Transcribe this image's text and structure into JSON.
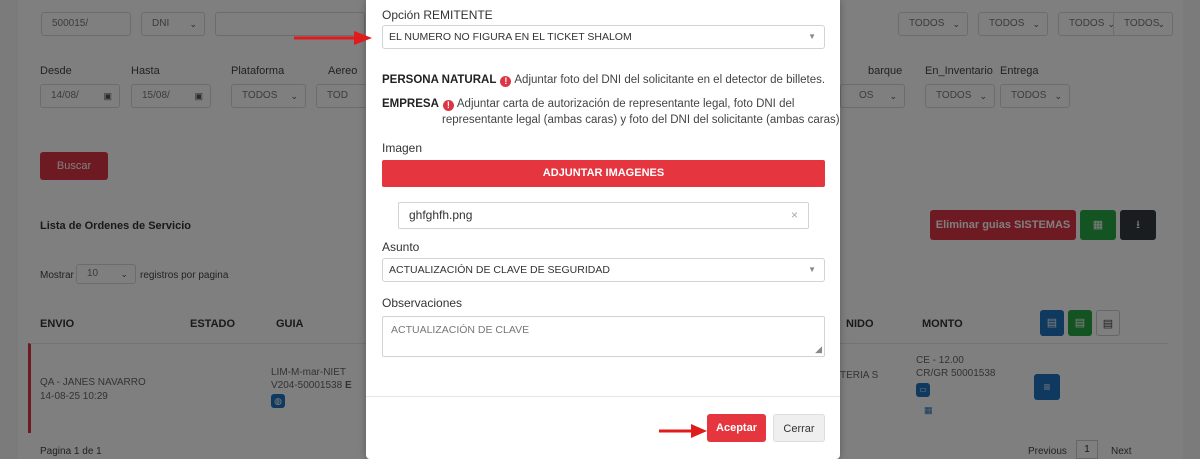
{
  "background": {
    "filter_row1": {
      "code_value": "500015/",
      "doc_type": "DNI",
      "right_selects": [
        "TODOS",
        "TODOS",
        "TODOS",
        "TODOS"
      ]
    },
    "filters": {
      "desde_label": "Desde",
      "desde_value": "14/08/",
      "hasta_label": "Hasta",
      "hasta_value": "15/08/",
      "plataforma_label": "Plataforma",
      "plataforma_value": "TODOS",
      "aereo_label": "Aereo",
      "aereo_value": "TOD",
      "embarque_label": "barque",
      "embarque_value": "OS",
      "inventario_label": "En_Inventario",
      "inventario_value": "TODOS",
      "entrega_label": "Entrega",
      "entrega_value": "TODOS"
    },
    "buscar_label": "Buscar",
    "list_title": "Lista de Ordenes de Servicio",
    "eliminar_label": "Eliminar guias SISTEMAS",
    "mostrar_label": "Mostrar",
    "mostrar_value": "10",
    "registros_label": "registros por pagina",
    "table_headers": [
      "ENVIO",
      "ESTADO",
      "GUIA",
      "NIDO",
      "MONTO"
    ],
    "row": {
      "envio_name": "QA - JANES NAVARRO",
      "envio_date": "14-08-25 10:29",
      "guia_line1": "LIM-M-mar-NIET",
      "guia_line2": "V204-50001538",
      "guia_mark": "E",
      "nido": "TERIA S",
      "monto_line1": "CE - 12.00",
      "monto_line2": "CR/GR 50001538"
    },
    "pagination_text": "Pagina 1 de 1",
    "previous_label": "Previous",
    "page_number": "1",
    "next_label": "Next"
  },
  "modal": {
    "remitente_label": "Opción REMITENTE",
    "remitente_value": "EL NUMERO NO FIGURA EN EL TICKET SHALOM",
    "persona_natural_title": "PERSONA NATURAL",
    "persona_natural_text": "Adjuntar foto del DNI del solicitante en el detector de billetes.",
    "empresa_title": "EMPRESA",
    "empresa_text_1": "Adjuntar carta de autorización de representante legal, foto DNI del",
    "empresa_text_2": "representante legal (ambas caras) y foto del DNI del solicitante (ambas caras)",
    "imagen_label": "Imagen",
    "adjuntar_label": "ADJUNTAR IMAGENES",
    "file_name": "ghfghfh.png",
    "asunto_label": "Asunto",
    "asunto_value": "ACTUALIZACIÓN DE CLAVE DE SEGURIDAD",
    "observaciones_label": "Observaciones",
    "observaciones_value": "ACTUALIZACIÓN DE CLAVE",
    "aceptar_label": "Aceptar",
    "cerrar_label": "Cerrar"
  },
  "colors": {
    "primary_red": "#e5353f",
    "arrow_red": "#e01b1b",
    "green": "#28a745",
    "blue": "#1e73be"
  },
  "icons": [
    "calendar-icon",
    "info-icon",
    "close-icon",
    "excel-icon",
    "download-icon",
    "menu-icon",
    "globe-icon",
    "arrow-icon"
  ]
}
